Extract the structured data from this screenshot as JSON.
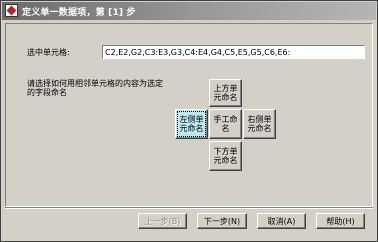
{
  "window": {
    "title": "定义单一数据项，第 [1] 步"
  },
  "cells": {
    "label": "选中单元格:",
    "value": "C2,E2,G2,C3:E3,G3,C4:E4,G4,C5,E5,G5,C6,E6:"
  },
  "prompt": {
    "text": "请选择如何用相邻单元格的内容为选定的字段命名"
  },
  "naming": {
    "top": "上方单元命名",
    "left": "左侧单元命名",
    "manual": "手工命名",
    "right": "右侧单元命名",
    "bottom": "下方单元命名"
  },
  "buttons": {
    "prev": "上一步(B)",
    "next": "下一步(N)",
    "cancel": "取消(A)",
    "help": "帮助(H)"
  }
}
